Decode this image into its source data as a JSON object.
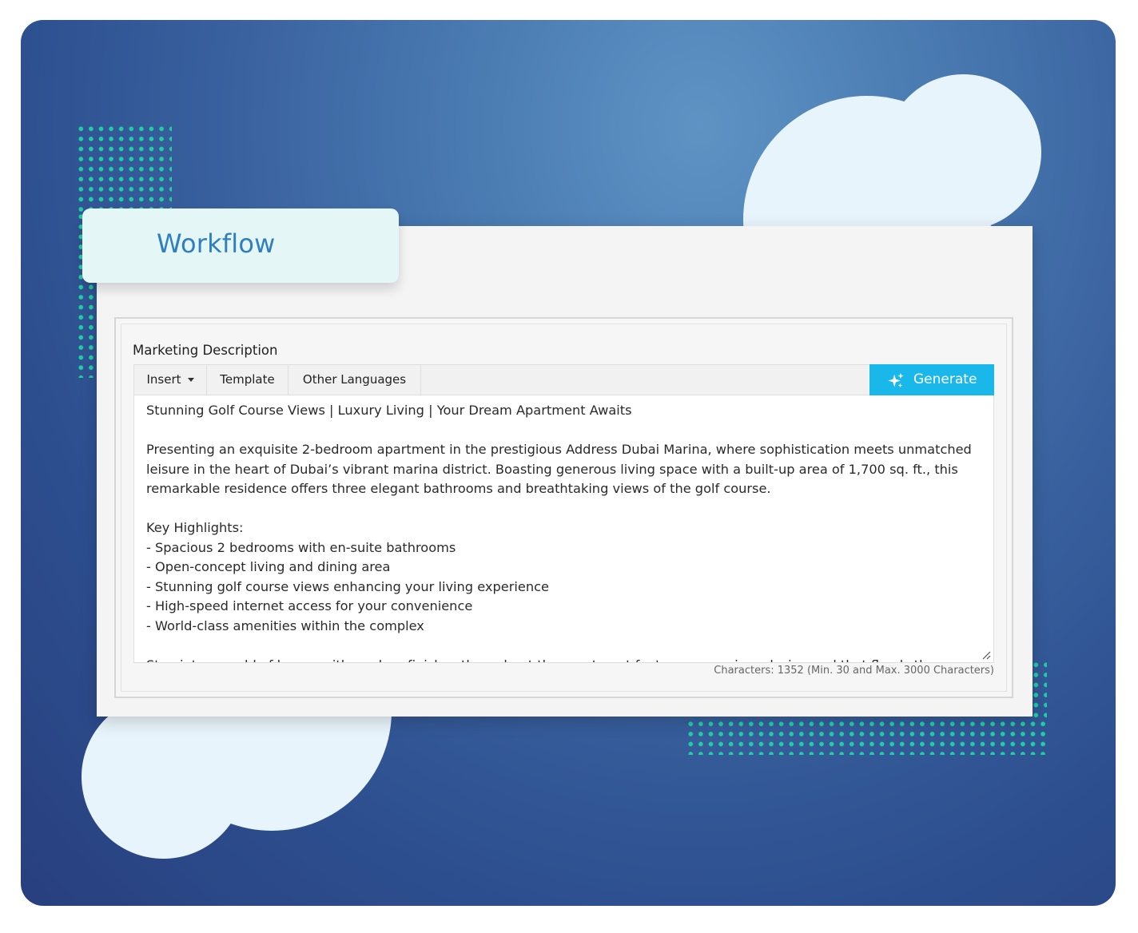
{
  "tag": {
    "title": "Workflow"
  },
  "form": {
    "field_label": "Marketing Description",
    "toolbar": {
      "insert_label": "Insert",
      "template_label": "Template",
      "other_languages_label": "Other Languages",
      "generate_label": "Generate"
    },
    "description": "Stunning Golf Course Views | Luxury Living | Your Dream Apartment Awaits\n\nPresenting an exquisite 2-bedroom apartment in the prestigious Address Dubai Marina, where sophistication meets unmatched leisure in the heart of Dubai’s vibrant marina district. Boasting generous living space with a built-up area of 1,700 sq. ft., this remarkable residence offers three elegant bathrooms and breathtaking views of the golf course.\n\nKey Highlights:\n- Spacious 2 bedrooms with en-suite bathrooms\n- Open-concept living and dining area\n- Stunning golf course views enhancing your living experience\n- High-speed internet access for your convenience\n- World-class amenities within the complex\n\nStep into a world of luxury with modern finishes throughout the apartment features a spacious design and that floods the",
    "char_count": "Characters: 1352 (Min. 30 and Max. 3000 Characters)"
  },
  "colors": {
    "accent": "#1ab7ea",
    "title_blue": "#2f7fc0",
    "dot_green": "#1fcfa4",
    "background_blue": "#2d4f8f"
  }
}
